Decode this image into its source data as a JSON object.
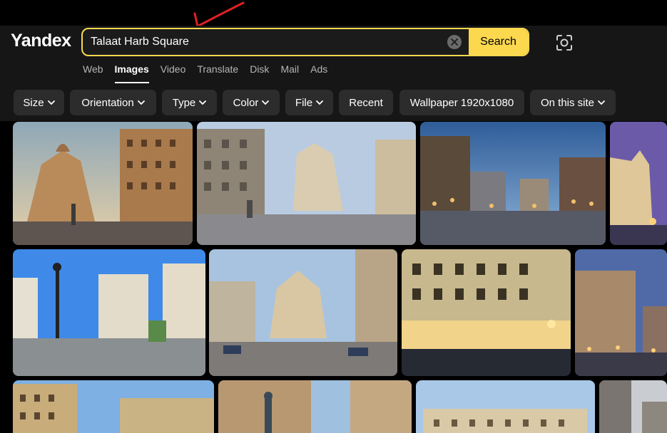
{
  "brand": {
    "logo": "Yandex"
  },
  "search": {
    "query": "Talaat Harb Square",
    "button_label": "Search"
  },
  "nav_tabs": [
    {
      "label": "Web",
      "active": false
    },
    {
      "label": "Images",
      "active": true
    },
    {
      "label": "Video",
      "active": false
    },
    {
      "label": "Translate",
      "active": false
    },
    {
      "label": "Disk",
      "active": false
    },
    {
      "label": "Mail",
      "active": false
    },
    {
      "label": "Ads",
      "active": false
    }
  ],
  "filters": [
    {
      "label": "Size",
      "dropdown": true
    },
    {
      "label": "Orientation",
      "dropdown": true
    },
    {
      "label": "Type",
      "dropdown": true
    },
    {
      "label": "Color",
      "dropdown": true
    },
    {
      "label": "File",
      "dropdown": true
    },
    {
      "label": "Recent",
      "dropdown": false
    },
    {
      "label": "Wallpaper 1920x1080",
      "dropdown": false
    },
    {
      "label": "On this site",
      "dropdown": true
    }
  ],
  "icons": {
    "clear": "close-circle-icon",
    "lens": "camera-lens-icon",
    "chevron": "chevron-down-icon",
    "annotation": "red-arrow-icon"
  },
  "colors": {
    "accent": "#fcd84f",
    "annotation": "#e02020",
    "chip_bg": "#2c2c2c",
    "header_bg": "#161616"
  },
  "results": [
    {
      "desc": "dusk square with domed corner building"
    },
    {
      "desc": "wide street view of square"
    },
    {
      "desc": "night scene with lit buildings"
    },
    {
      "desc": "cropped sunset facade"
    },
    {
      "desc": "street lamp and buildings in daylight"
    },
    {
      "desc": "view down street toward domed building"
    },
    {
      "desc": "hotel facade at night"
    },
    {
      "desc": "buildings at dusk"
    },
    {
      "desc": "ornate building close-up"
    },
    {
      "desc": "statue in front of buildings"
    },
    {
      "desc": "facade with blue sky"
    },
    {
      "desc": "cropped gray building"
    }
  ]
}
